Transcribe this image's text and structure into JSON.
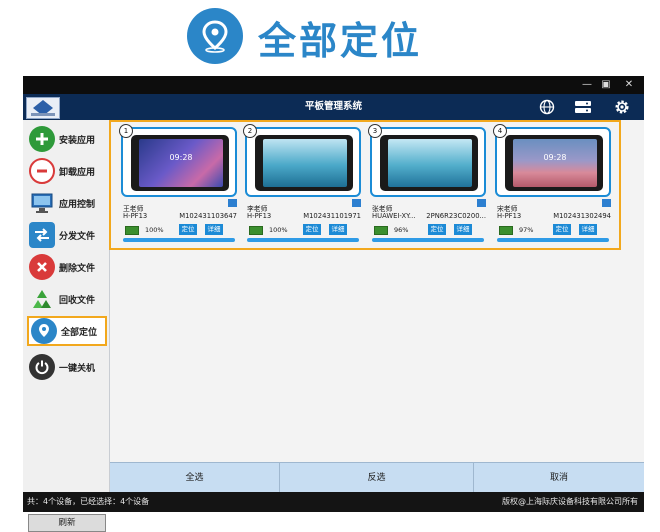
{
  "hero": {
    "title": "全部定位"
  },
  "window": {
    "minimize": "—",
    "maximize": "▣",
    "close": "✕",
    "app_title": "平板管理系统"
  },
  "sidebar": {
    "items": [
      {
        "label": "安装应用",
        "icon": "plus-icon",
        "color": "#2e9a3a"
      },
      {
        "label": "卸载应用",
        "icon": "minus-icon",
        "color": "#d93a3a"
      },
      {
        "label": "应用控制",
        "icon": "monitor-icon",
        "color": "#2a6fb8"
      },
      {
        "label": "分发文件",
        "icon": "arrows-icon",
        "color": "#2b86c8"
      },
      {
        "label": "删除文件",
        "icon": "x-icon",
        "color": "#d93a3a"
      },
      {
        "label": "回收文件",
        "icon": "recycle-icon",
        "color": "#3aa33a"
      },
      {
        "label": "全部定位",
        "icon": "location-icon",
        "color": "#2b86c8"
      },
      {
        "label": "一键关机",
        "icon": "power-icon",
        "color": "#333333"
      }
    ],
    "refresh_label": "刷新"
  },
  "devices": [
    {
      "num": "1",
      "teacher": "王老师",
      "model": "H-PF13",
      "serial": "M102431103647",
      "battery": "100%",
      "clock": "09:28",
      "locate": "定位",
      "detail": "详细"
    },
    {
      "num": "2",
      "teacher": "李老师",
      "model": "H-PF13",
      "serial": "M102431101971",
      "battery": "100%",
      "clock": "",
      "locate": "定位",
      "detail": "详细"
    },
    {
      "num": "3",
      "teacher": "张老师",
      "model": "HUAWEI-XY...",
      "serial": "2PN6R23C0200...",
      "battery": "96%",
      "clock": "",
      "locate": "定位",
      "detail": "详细"
    },
    {
      "num": "4",
      "teacher": "宋老师",
      "model": "H-PF13",
      "serial": "M102431302494",
      "battery": "97%",
      "clock": "09:28",
      "locate": "定位",
      "detail": "详细"
    }
  ],
  "bottom": {
    "select_all": "全选",
    "invert": "反选",
    "cancel": "取消"
  },
  "status": {
    "left": "共：4个设备，已经选择：4个设备",
    "right": "版权@上海际庆设备科技有限公司所有"
  },
  "colors": {
    "accent": "#2b86c8",
    "highlight": "#f2a81d",
    "titlebar": "#0c2b55"
  }
}
